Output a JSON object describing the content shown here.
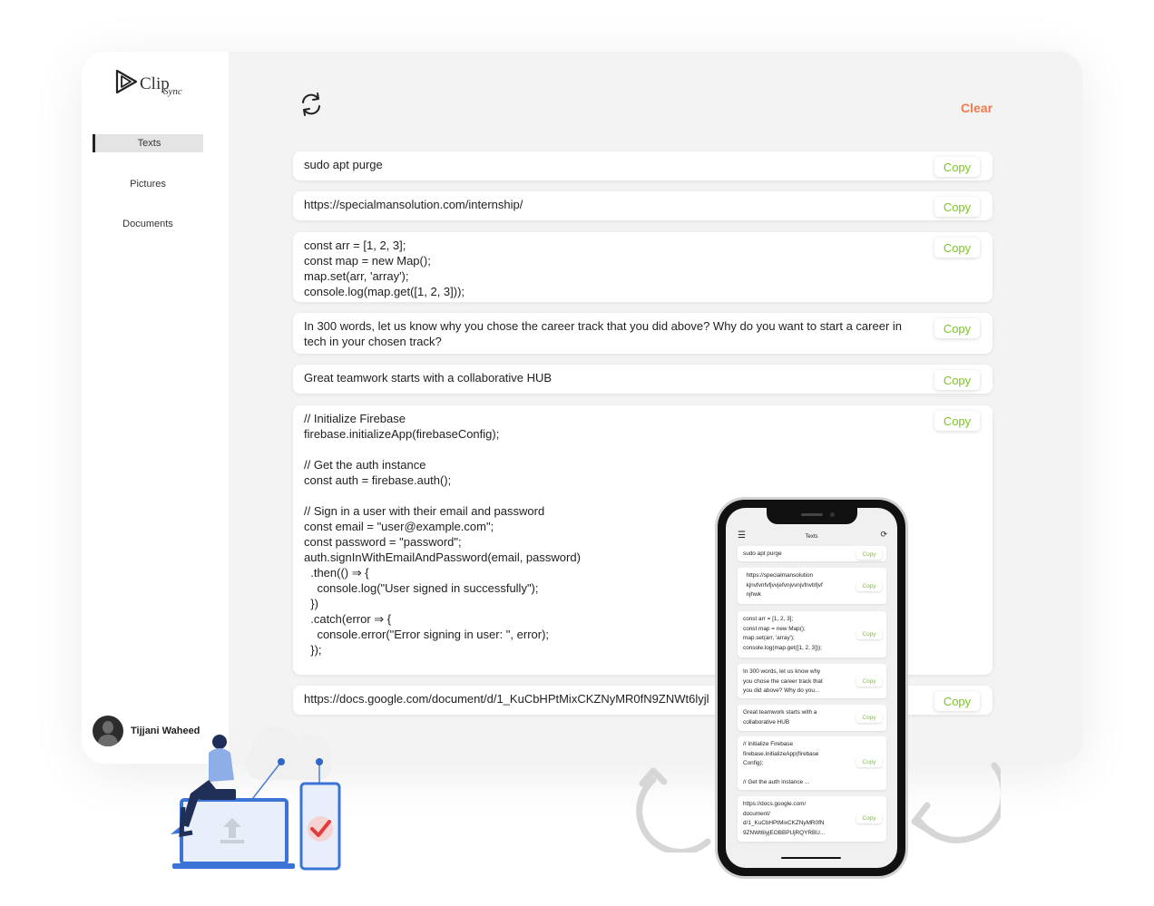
{
  "app": {
    "logo": {
      "word": "Clip",
      "sub": "Sync"
    },
    "nav": [
      {
        "label": "Texts",
        "active": true
      },
      {
        "label": "Pictures",
        "active": false
      },
      {
        "label": "Documents",
        "active": false
      }
    ],
    "user": {
      "name": "Tijjani Waheed"
    }
  },
  "header": {
    "refresh_icon": "refresh-icon",
    "clear_label": "Clear"
  },
  "clips": [
    {
      "text": "sudo apt purge",
      "copy_label": "Copy"
    },
    {
      "text": "https://specialmansolution.com/internship/",
      "copy_label": "Copy"
    },
    {
      "text": "const arr = [1, 2, 3];\nconst map = new Map();\nmap.set(arr, 'array');\nconsole.log(map.get([1, 2, 3]));",
      "copy_label": "Copy"
    },
    {
      "text": "In 300 words, let us know why you chose the career track that you did above? Why do you want to start a career in\ntech in your chosen track?",
      "copy_label": "Copy"
    },
    {
      "text": "Great teamwork starts with a collaborative HUB",
      "copy_label": "Copy"
    },
    {
      "text": "// Initialize Firebase\nfirebase.initializeApp(firebaseConfig);\n\n// Get the auth instance\nconst auth = firebase.auth();\n\n// Sign in a user with their email and password\nconst email = \"user@example.com\";\nconst password = \"password\";\nauth.signInWithEmailAndPassword(email, password)\n  .then(() ⇒ {\n    console.log(\"User signed in successfully\");\n  })\n  .catch(error ⇒ {\n    console.error(\"Error signing in user: \", error);\n  });",
      "copy_label": "Copy"
    },
    {
      "text": "https://docs.google.com/document/d/1_KuCbHPtMixCKZNyMR0fN9ZNWt6lyjl",
      "copy_label": "Copy"
    }
  ],
  "phone": {
    "title": "Texts",
    "copy_label": "Copy",
    "clips": [
      "sudo apt purge",
      "  https://specialmansolution\n  kjnvfvnfvfjvvjefvnjvvnjvfnvbfjvf\n  njhwk",
      "const arr = [1, 2, 3];\nconst map = new Map();\nmap.set(arr, 'array');\nconsole.log(map.get([1, 2, 3]));",
      "In 300 words, let us know why\nyou chose the career track that\nyou did above? Why do you...",
      "Great teamwork starts with a\ncollaborative HUB",
      "// Initialize Firebase\nfirebase.initializeApp(firebase\nConfig);\n\n// Get the auth instance ...",
      "https://docs.google.com/\ndocument/\nd/1_KuCbHPtMixCKZNyMR0fN\n9ZNWt6lyjEOBBPUjRQYRBU..."
    ]
  },
  "colors": {
    "accent_copy": "#7cc52a",
    "accent_clear": "#ee7a4d"
  }
}
